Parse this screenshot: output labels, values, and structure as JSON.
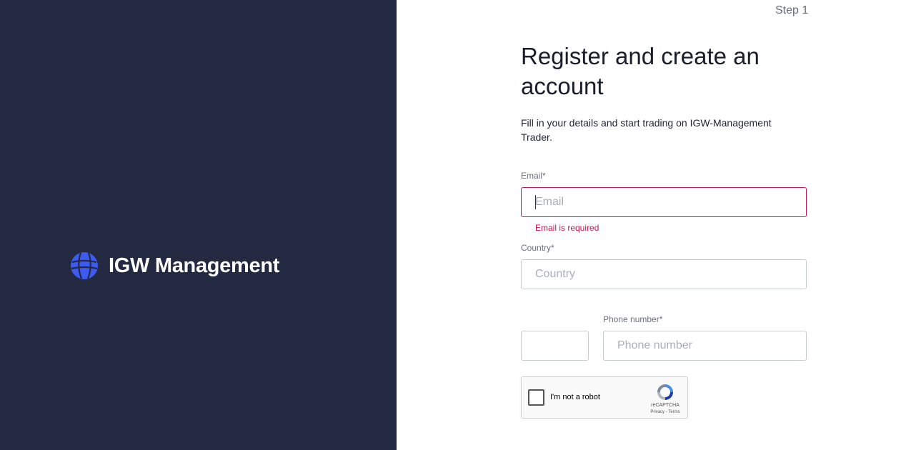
{
  "brand": {
    "name": "IGW Management",
    "logo_icon": "globe-icon",
    "color": "#3d5af1"
  },
  "step": {
    "label": "Step 1"
  },
  "form": {
    "title": "Register and create an account",
    "subtitle": "Fill in your details and start trading on IGW-Management Trader.",
    "email": {
      "label": "Email*",
      "placeholder": "Email",
      "value": "",
      "error": "Email is required"
    },
    "country": {
      "label": "Country*",
      "placeholder": "Country",
      "value": ""
    },
    "phone_code": {
      "value": ""
    },
    "phone": {
      "label": "Phone number*",
      "placeholder": "Phone number",
      "value": ""
    }
  },
  "recaptcha": {
    "label": "I'm not a robot",
    "brand": "reCAPTCHA",
    "links": "Privacy - Terms"
  },
  "colors": {
    "left_panel_bg": "#242942",
    "error": "#d0144f",
    "accent": "#3d5af1"
  }
}
